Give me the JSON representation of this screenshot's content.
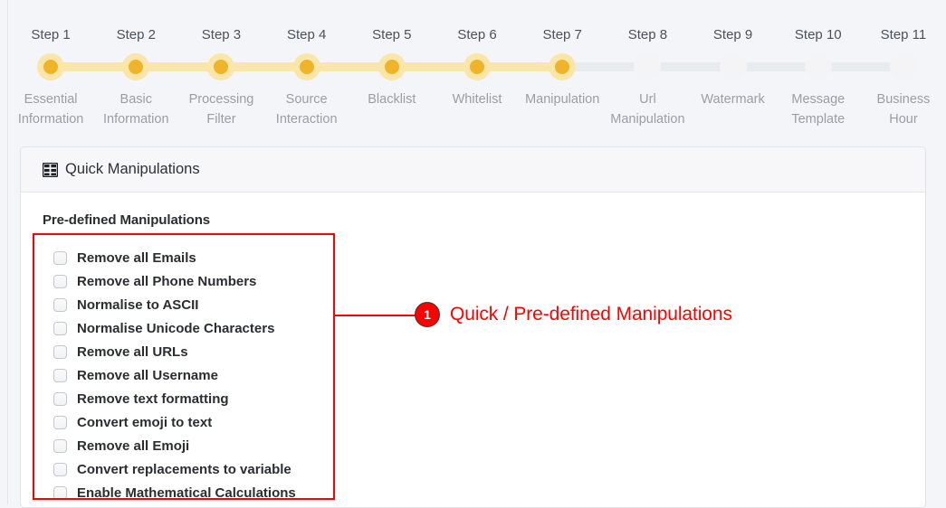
{
  "stepper": {
    "steps": [
      {
        "title": "Step 1",
        "label": "Essential Information",
        "state": "active"
      },
      {
        "title": "Step 2",
        "label": "Basic Information",
        "state": "active"
      },
      {
        "title": "Step 3",
        "label": "Processing Filter",
        "state": "active"
      },
      {
        "title": "Step 4",
        "label": "Source Interaction",
        "state": "active"
      },
      {
        "title": "Step 5",
        "label": "Blacklist",
        "state": "active"
      },
      {
        "title": "Step 6",
        "label": "Whitelist",
        "state": "active"
      },
      {
        "title": "Step 7",
        "label": "Manipulation",
        "state": "active"
      },
      {
        "title": "Step 8",
        "label": "Url Manipulation",
        "state": "inactive"
      },
      {
        "title": "Step 9",
        "label": "Watermark",
        "state": "inactive"
      },
      {
        "title": "Step 10",
        "label": "Message Template",
        "state": "inactive"
      },
      {
        "title": "Step 11",
        "label": "Business Hour",
        "state": "inactive"
      }
    ],
    "colors": {
      "active_ring": "#fae6a8",
      "active_dot": "#efb429",
      "inactive": "#f4f4f6",
      "line_inactive": "#e9ecef"
    }
  },
  "card": {
    "header": {
      "icon": "table-grid-icon",
      "title": "Quick Manipulations"
    },
    "section_title": "Pre-defined Manipulations",
    "checkboxes": [
      {
        "label": "Remove all Emails",
        "checked": false
      },
      {
        "label": "Remove all Phone Numbers",
        "checked": false
      },
      {
        "label": "Normalise to ASCII",
        "checked": false
      },
      {
        "label": "Normalise Unicode Characters",
        "checked": false
      },
      {
        "label": "Remove all URLs",
        "checked": false
      },
      {
        "label": "Remove all Username",
        "checked": false
      },
      {
        "label": "Remove text formatting",
        "checked": false
      },
      {
        "label": "Convert emoji to text",
        "checked": false
      },
      {
        "label": "Remove all Emoji",
        "checked": false
      },
      {
        "label": "Convert replacements to variable",
        "checked": false
      },
      {
        "label": "Enable Mathematical Calculations",
        "checked": false
      }
    ]
  },
  "annotation": {
    "number": "1",
    "text": "Quick / Pre-defined Manipulations",
    "color": "#fe0000"
  }
}
